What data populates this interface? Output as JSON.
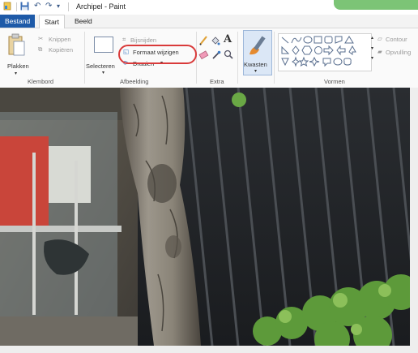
{
  "window": {
    "title": "Archipel - Paint"
  },
  "quick_access": {
    "save_glyph": "💾",
    "undo_glyph": "↶",
    "redo_glyph": "↷",
    "menu_glyph": "▾"
  },
  "tabs": [
    {
      "label": "Bestand"
    },
    {
      "label": "Start"
    },
    {
      "label": "Beeld"
    }
  ],
  "ribbon": {
    "clipboard": {
      "paste": "Plakken",
      "cut": "Knippen",
      "copy": "Kopiëren",
      "group": "Klembord"
    },
    "image": {
      "select": "Selecteren",
      "crop": "Bijsnijden",
      "resize": "Formaat wijzigen",
      "rotate": "Draaien",
      "group": "Afbeelding"
    },
    "tools": {
      "group": "Extra",
      "text_glyph": "A"
    },
    "brushes": {
      "label": "Kwasten"
    },
    "shapes": {
      "outline": "Contour",
      "fill": "Opvulling",
      "group": "Vormen"
    }
  },
  "colors": {
    "accent": "#7cc476",
    "file_tab": "#1e5aa8",
    "highlight": "#d93a3a"
  }
}
